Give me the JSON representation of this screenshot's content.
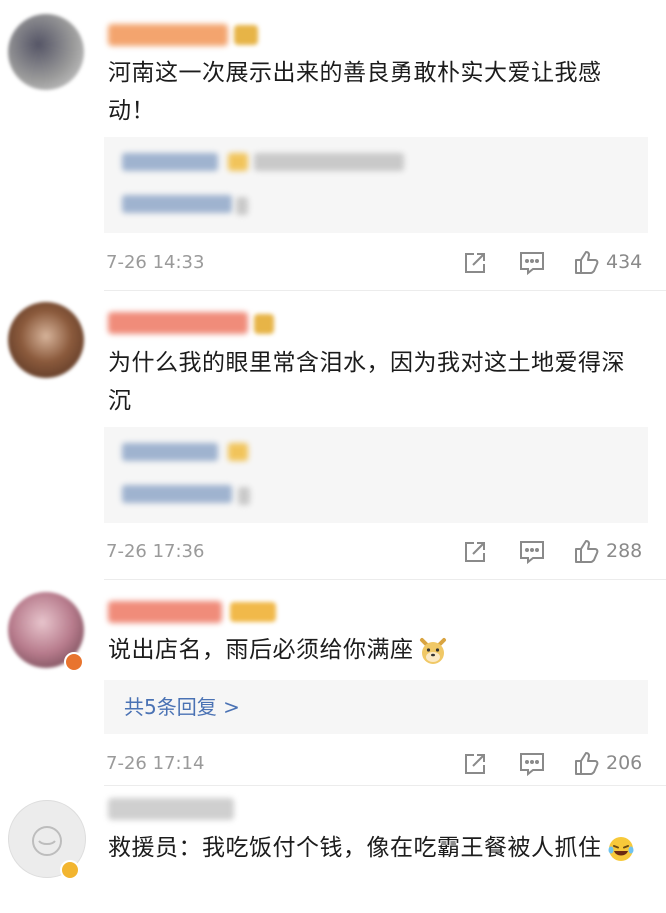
{
  "comments": [
    {
      "text": "河南这一次展示出来的善良勇敢朴实大爱让我感动！",
      "time": "7-26 14:33",
      "likes": "434"
    },
    {
      "text": "为什么我的眼里常含泪水，因为我对这土地爱得深沉",
      "time": "7-26 17:36",
      "likes": "288"
    },
    {
      "text": "说出店名，雨后必须给你满座",
      "emoji": "dog-face-emoji",
      "reply_link": "共5条回复 >",
      "time": "7-26 17:14",
      "likes": "206"
    },
    {
      "text": "救援员：我吃饭付个钱，像在吃霸王餐被人抓住",
      "emoji": "laughing-tears-emoji"
    }
  ],
  "colors": {
    "link": "#4a72b4",
    "meta": "#9a9a9a",
    "reply_bg": "#f6f6f6"
  }
}
